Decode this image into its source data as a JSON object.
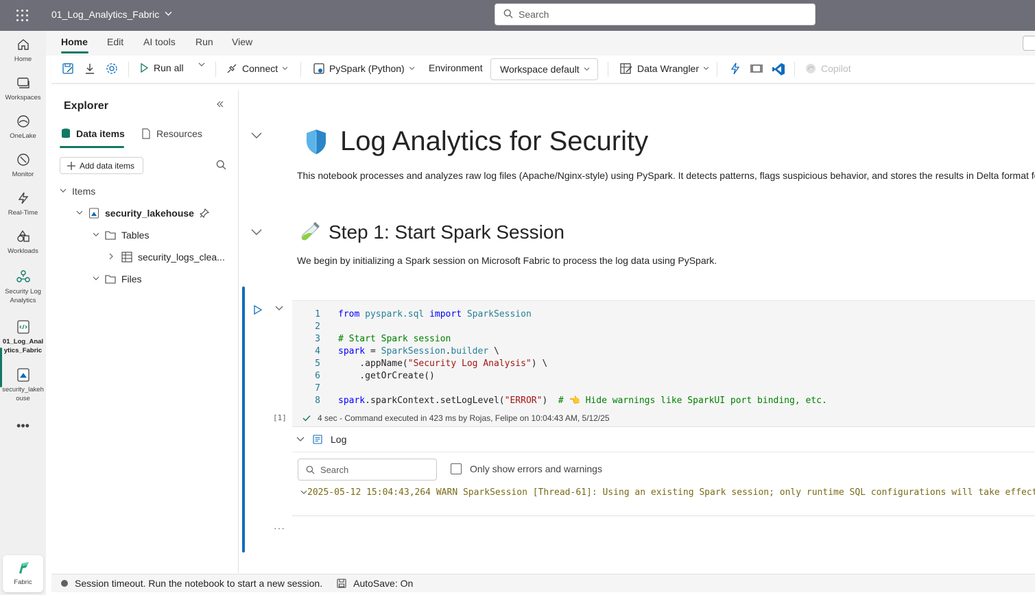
{
  "topbar": {
    "title": "01_Log_Analytics_Fabric",
    "search_placeholder": "Search"
  },
  "rail": {
    "items": [
      {
        "label": "Home",
        "icon": "home-icon"
      },
      {
        "label": "Workspaces",
        "icon": "workspaces-icon"
      },
      {
        "label": "OneLake",
        "icon": "onelake-icon"
      },
      {
        "label": "Monitor",
        "icon": "monitor-icon"
      },
      {
        "label": "Real-Time",
        "icon": "realtime-icon"
      },
      {
        "label": "Workloads",
        "icon": "workloads-icon"
      },
      {
        "label": "Security Log Analytics",
        "icon": "workspace-group-icon"
      },
      {
        "label": "01_Log_Analytics_Fabric",
        "icon": "notebook-icon"
      },
      {
        "label": "security_lakehouse",
        "icon": "lakehouse-icon"
      }
    ],
    "fabric_label": "Fabric"
  },
  "menu": {
    "tabs": [
      "Home",
      "Edit",
      "AI tools",
      "Run",
      "View"
    ],
    "active": "Home"
  },
  "toolbar": {
    "run_all": "Run all",
    "connect": "Connect",
    "language": "PySpark (Python)",
    "environment": "Environment",
    "workspace_default": "Workspace default",
    "data_wrangler": "Data Wrangler",
    "copilot": "Copilot"
  },
  "explorer": {
    "title": "Explorer",
    "tabs": [
      "Data items",
      "Resources"
    ],
    "add_data_items": "Add data items",
    "tree": {
      "items": "Items",
      "lakehouse": "security_lakehouse",
      "tables": "Tables",
      "table1": "security_logs_clea...",
      "files": "Files"
    }
  },
  "notebook": {
    "h1": "Log Analytics for Security",
    "p1": "This notebook processes and analyzes raw log files (Apache/Nginx-style) using PySpark. It detects patterns, flags suspicious behavior, and stores the results in Delta format for",
    "h2": "Step 1: Start Spark Session",
    "p2": "We begin by initializing a Spark session on Microsoft Fabric to process the log data using PySpark.",
    "code_lines": [
      "from pyspark.sql import SparkSession",
      "",
      "# Start Spark session",
      "spark = SparkSession.builder \\",
      "    .appName(\"Security Log Analysis\") \\",
      "    .getOrCreate()",
      "",
      "spark.sparkContext.setLogLevel(\"ERROR\")  # 👈 Hide warnings like SparkUI port binding, etc."
    ],
    "exec_count": "[1]",
    "status": "4 sec - Command executed in 423 ms by Rojas, Felipe on 10:04:43 AM, 5/12/25",
    "log": {
      "title": "Log",
      "search_placeholder": "Search",
      "only_errors": "Only show errors and warnings",
      "line": "2025-05-12 15:04:43,264 WARN SparkSession [Thread-61]: Using an existing Spark session; only runtime SQL configurations will take effect."
    }
  },
  "statusbar": {
    "session": "Session timeout. Run the notebook to start a new session.",
    "autosave": "AutoSave: On"
  },
  "colors": {
    "accent": "#117865",
    "cell_accent": "#0f6cbd",
    "topbar": "#6e6e78"
  }
}
